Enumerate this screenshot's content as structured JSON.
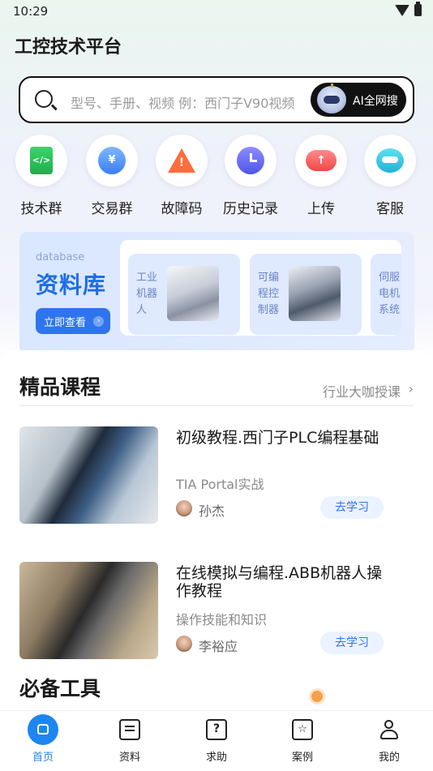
{
  "status_bar": {
    "time": "10:29"
  },
  "header": {
    "title": "工控技术平台"
  },
  "search": {
    "placeholder": "型号、手册、视频 例：西门子V90视频",
    "ai_button_label": "AI全网搜"
  },
  "quick_actions": [
    {
      "label": "技术群",
      "icon": "document-code-icon",
      "glyph": "</>"
    },
    {
      "label": "交易群",
      "icon": "yen-hand-icon",
      "glyph": "¥"
    },
    {
      "label": "故障码",
      "icon": "warning-icon",
      "glyph": "!"
    },
    {
      "label": "历史记录",
      "icon": "clock-icon",
      "glyph": ""
    },
    {
      "label": "上传",
      "icon": "cloud-upload-icon",
      "glyph": "↑"
    },
    {
      "label": "客服",
      "icon": "headset-icon",
      "glyph": ""
    }
  ],
  "database": {
    "label_en": "database",
    "title": "资料库",
    "button_label": "立即查看",
    "items": [
      {
        "label": "工业机器人",
        "image": "industrial-robot-image"
      },
      {
        "label": "可编程控制器",
        "image": "plc-image"
      },
      {
        "label": "伺服电机系统",
        "image": "servo-motor-image"
      }
    ]
  },
  "courses_section": {
    "title": "精品课程",
    "more_label": "行业大咖授课"
  },
  "courses": [
    {
      "title": "初级教程.西门子PLC编程基础",
      "subtitle": "TIA Portal实战",
      "author": "孙杰",
      "button_label": "去学习"
    },
    {
      "title": "在线模拟与编程.ABB机器人操作教程",
      "subtitle": "操作技能和知识",
      "author": "李裕应",
      "button_label": "去学习"
    }
  ],
  "tools_section": {
    "title": "必备工具"
  },
  "tab_bar": {
    "active": "首页",
    "items": [
      {
        "label": "首页",
        "icon": "home-icon"
      },
      {
        "label": "资料",
        "icon": "note-icon"
      },
      {
        "label": "求助",
        "icon": "help-icon"
      },
      {
        "label": "案例",
        "icon": "star-case-icon"
      },
      {
        "label": "我的",
        "icon": "user-icon"
      }
    ]
  },
  "colors": {
    "accent": "#1d86f0",
    "db_title": "#1f6de6",
    "course_button_bg": "#eaf3ff"
  }
}
